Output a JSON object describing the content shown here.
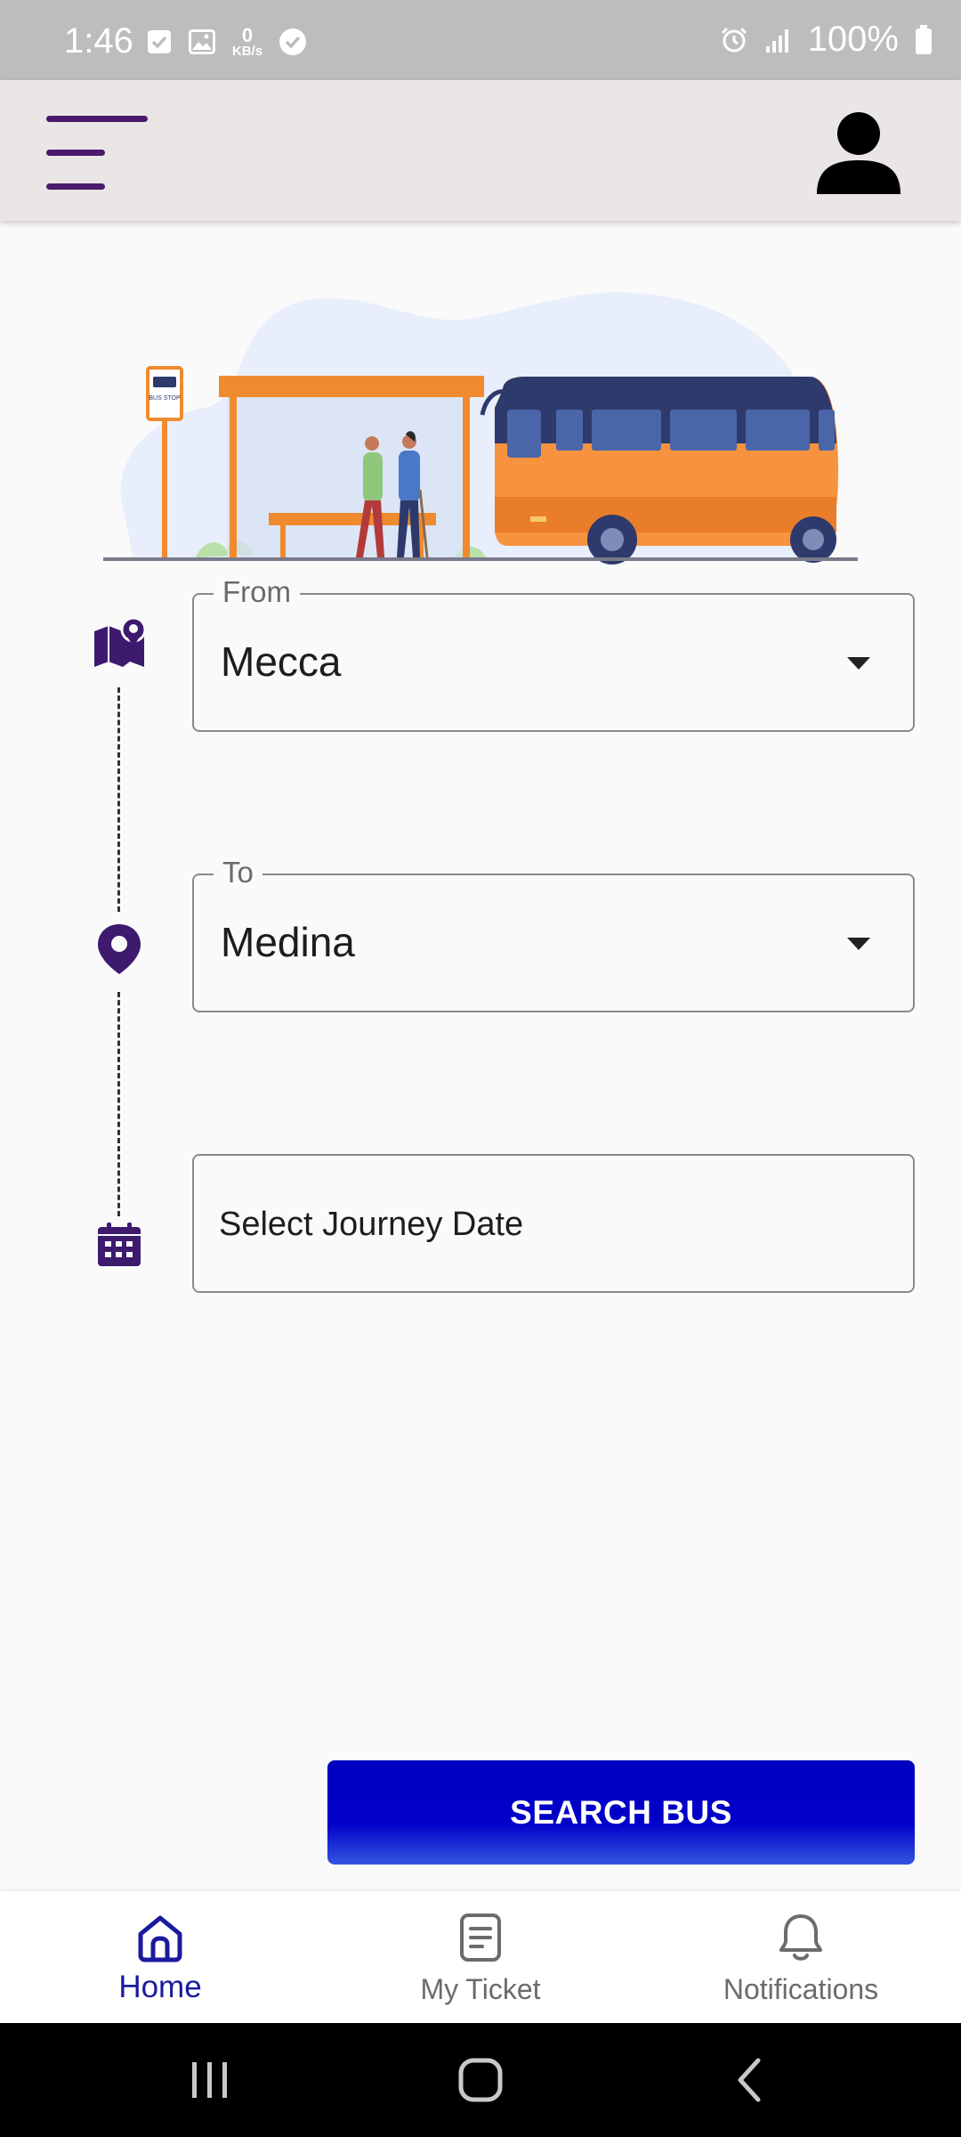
{
  "status_bar": {
    "time": "1:46",
    "network_speed_value": "0",
    "network_speed_unit": "KB/s",
    "battery": "100%"
  },
  "app_bar": {
    "menu_icon": "menu-icon",
    "profile_icon": "person-icon"
  },
  "hero": {
    "bus_stop_sign": "BUS STOP",
    "colors": {
      "bus_body": "#f7923e",
      "bus_roof": "#2d3a6b",
      "shelter": "#f08a2e",
      "blob": "#e8eefb"
    }
  },
  "form": {
    "from": {
      "label": "From",
      "value": "Mecca",
      "icon": "map-icon"
    },
    "to": {
      "label": "To",
      "value": "Medina",
      "icon": "location-pin-icon"
    },
    "date": {
      "placeholder": "Select Journey Date",
      "icon": "calendar-icon"
    },
    "icon_color": "#3d1a6e"
  },
  "search_button": {
    "label": "SEARCH BUS",
    "color": "#0000c8"
  },
  "bottom_nav": {
    "items": [
      {
        "label": "Home",
        "icon": "home-icon",
        "active": true
      },
      {
        "label": "My Ticket",
        "icon": "ticket-icon",
        "active": false
      },
      {
        "label": "Notifications",
        "icon": "bell-icon",
        "active": false
      }
    ],
    "active_color": "#1a1a9e"
  }
}
